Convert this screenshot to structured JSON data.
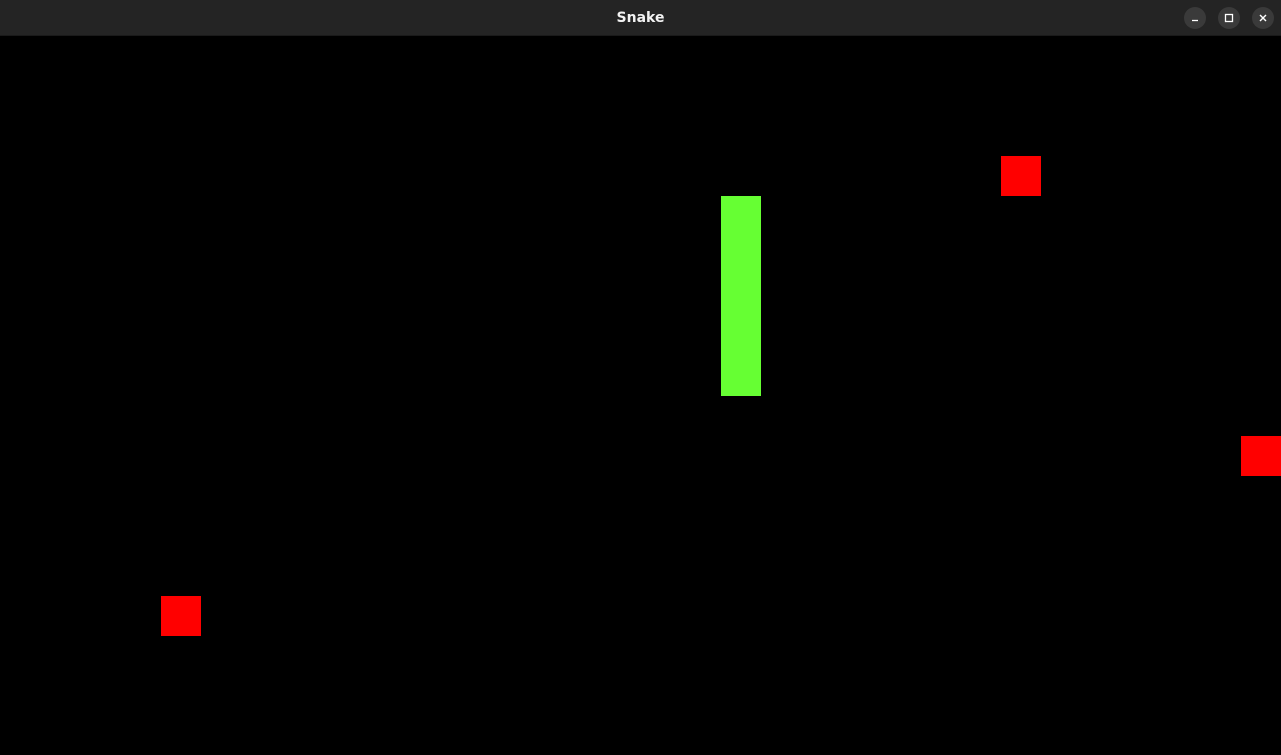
{
  "window": {
    "title": "Snake",
    "minimize_icon": "minimize-icon",
    "maximize_icon": "maximize-icon",
    "close_icon": "close-icon"
  },
  "game": {
    "background_color": "#000000",
    "snake_color": "#66ff33",
    "food_color": "#ff0000",
    "snake": [
      [
        18,
        4
      ],
      [
        18,
        5
      ],
      [
        18,
        6
      ],
      [
        18,
        7
      ],
      [
        18,
        8
      ]
    ],
    "food": [
      [
        25,
        3
      ],
      [
        31,
        10
      ],
      [
        4,
        14
      ]
    ]
  }
}
